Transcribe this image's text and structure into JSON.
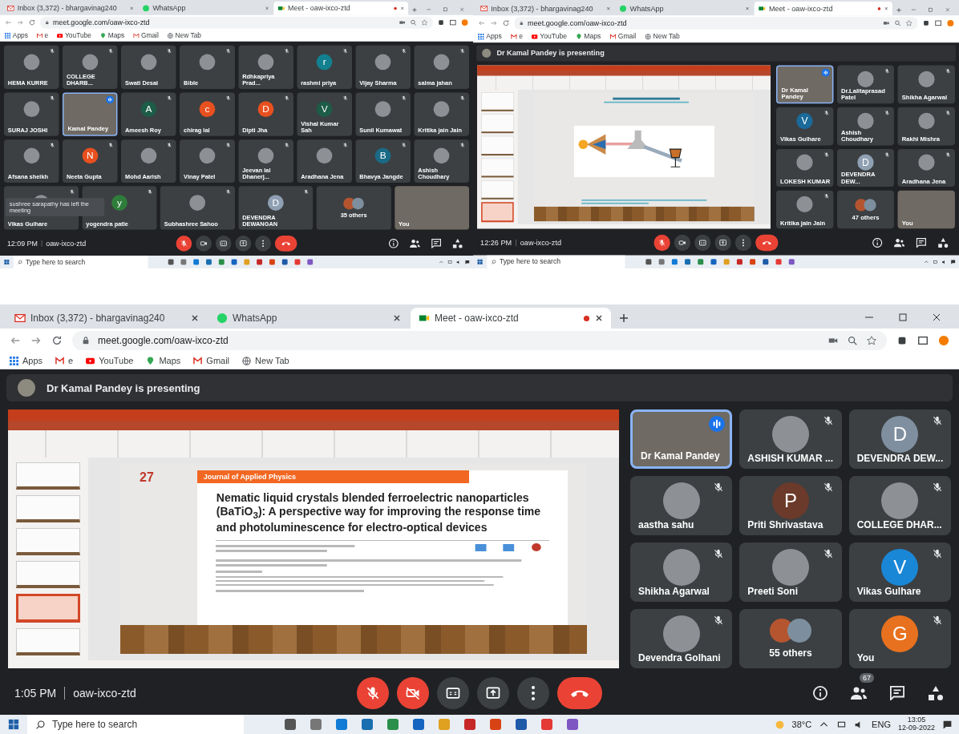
{
  "screens": [
    {
      "kind": "grid",
      "browser": {
        "tabs": [
          {
            "title": "Inbox (3,372) - bhargavinag240",
            "selected": false,
            "recording": false
          },
          {
            "title": "WhatsApp",
            "selected": false,
            "recording": false
          },
          {
            "title": "Meet - oaw-ixco-ztd",
            "selected": true,
            "recording": true
          }
        ],
        "url": "meet.google.com/oaw-ixco-ztd",
        "bookmarks": [
          "Apps",
          "e",
          "YouTube",
          "Maps",
          "Gmail",
          "New Tab"
        ]
      },
      "tiles": [
        {
          "name": "HEMA KURRE",
          "kind": "photo",
          "muted": true,
          "speaking": false
        },
        {
          "name": "COLLEGE DHARB...",
          "kind": "photo",
          "muted": true,
          "speaking": false
        },
        {
          "name": "Swati Desai",
          "kind": "photo",
          "muted": true,
          "speaking": false
        },
        {
          "name": "Bible",
          "kind": "photo",
          "muted": true,
          "speaking": false
        },
        {
          "name": "Rdhkapriya Prad...",
          "kind": "photo",
          "muted": true,
          "speaking": false
        },
        {
          "name": "rashmi priya",
          "kind": "letter",
          "letter": "r",
          "color": "#12808f",
          "muted": true,
          "speaking": false
        },
        {
          "name": "Vijay Sharma",
          "kind": "photo",
          "muted": true,
          "speaking": false
        },
        {
          "name": "salma jahan",
          "kind": "photo",
          "muted": true,
          "speaking": false
        },
        {
          "name": "SURAJ JOSHI",
          "kind": "photo",
          "muted": true,
          "speaking": false
        },
        {
          "name": "Kamal Pandey",
          "kind": "video",
          "muted": false,
          "speaking": true
        },
        {
          "name": "Ameesh Roy",
          "kind": "letter",
          "letter": "A",
          "color": "#1d5c47",
          "muted": true,
          "speaking": false
        },
        {
          "name": "chirag lal",
          "kind": "letter",
          "letter": "c",
          "color": "#e8501f",
          "muted": true,
          "speaking": false
        },
        {
          "name": "Dipti Jha",
          "kind": "letter",
          "letter": "D",
          "color": "#e8501f",
          "muted": true,
          "speaking": false
        },
        {
          "name": "Vishal Kumar Sah",
          "kind": "letter",
          "letter": "V",
          "color": "#1d5c47",
          "muted": true,
          "speaking": false
        },
        {
          "name": "Sunil Kumawat",
          "kind": "photo",
          "muted": true,
          "speaking": false
        },
        {
          "name": "Kritika jain Jain",
          "kind": "photo",
          "muted": true,
          "speaking": false
        },
        {
          "name": "Afsana sheikh",
          "kind": "photo",
          "muted": true,
          "speaking": false
        },
        {
          "name": "Neeta Gupta",
          "kind": "letter",
          "letter": "N",
          "color": "#e8501f",
          "muted": true,
          "speaking": false
        },
        {
          "name": "Mohd Aarish",
          "kind": "photo",
          "muted": true,
          "speaking": false
        },
        {
          "name": "Vinay Patel",
          "kind": "photo",
          "muted": true,
          "speaking": false
        },
        {
          "name": "Jeevan lal Dhanerj...",
          "kind": "photo",
          "muted": true,
          "speaking": false
        },
        {
          "name": "Aradhana Jena",
          "kind": "photo",
          "muted": true,
          "speaking": false
        },
        {
          "name": "Bhavya Jangde",
          "kind": "letter",
          "letter": "B",
          "color": "#1a6a86",
          "muted": true,
          "speaking": false
        },
        {
          "name": "Ashish Choudhary",
          "kind": "photo",
          "muted": true,
          "speaking": false
        },
        {
          "name": "Vikas Gulhare",
          "kind": "photo",
          "muted": true,
          "speaking": false
        },
        {
          "name": "yogendra patle",
          "kind": "letter",
          "letter": "y",
          "color": "#2f7d3a",
          "muted": true,
          "speaking": false
        },
        {
          "name": "Subhashree Sahoo",
          "kind": "photo",
          "muted": true,
          "speaking": false
        },
        {
          "name": "DEVENDRA DEWANGAN",
          "kind": "letter",
          "letter": "D",
          "color": "#8fa0b3",
          "muted": true,
          "speaking": false
        },
        {
          "name": "35 others",
          "kind": "group",
          "muted": false,
          "speaking": false
        },
        {
          "name": "You",
          "kind": "video",
          "muted": false,
          "speaking": false
        }
      ],
      "notification": "sushree sarapathy has left the meeting",
      "time": "12:09 PM",
      "code": "oaw-ixco-ztd",
      "controls": {
        "mic_on": false,
        "camera_on": true
      },
      "taskbar": {
        "search_placeholder": "Type here to search"
      }
    },
    {
      "kind": "presenting",
      "browser": {
        "tabs": [
          {
            "title": "Inbox (3,372) - bhargavinag240",
            "selected": false,
            "recording": false
          },
          {
            "title": "WhatsApp",
            "selected": false,
            "recording": false
          },
          {
            "title": "Meet - oaw-ixco-ztd",
            "selected": true,
            "recording": true
          }
        ],
        "url": "meet.google.com/oaw-ixco-ztd",
        "bookmarks": [
          "Apps",
          "e",
          "YouTube",
          "Maps",
          "Gmail",
          "New Tab"
        ]
      },
      "banner": "Dr Kamal Pandey is presenting",
      "slide": {
        "kind": "diagram",
        "thumbnails": [
          {
            "selected": false
          },
          {
            "selected": false
          },
          {
            "selected": false
          },
          {
            "selected": false
          },
          {
            "selected": false
          },
          {
            "selected": true
          }
        ]
      },
      "tiles": [
        {
          "name": "Dr Kamal Pandey",
          "kind": "video",
          "muted": false,
          "speaking": true
        },
        {
          "name": "Dr.Lalitaprasad Patel",
          "kind": "photo",
          "muted": true,
          "speaking": false
        },
        {
          "name": "Shikha Agarwal",
          "kind": "photo",
          "muted": true,
          "speaking": false
        },
        {
          "name": "Vikas Gulhare",
          "kind": "letter",
          "letter": "V",
          "color": "#1a6a9a",
          "muted": true,
          "speaking": false
        },
        {
          "name": "Ashish Choudhary",
          "kind": "photo",
          "muted": true,
          "speaking": false
        },
        {
          "name": "Rakhi Mishra",
          "kind": "photo",
          "muted": true,
          "speaking": false
        },
        {
          "name": "LOKESH KUMAR",
          "kind": "photo",
          "muted": true,
          "speaking": false
        },
        {
          "name": "DEVENDRA DEW...",
          "kind": "letter",
          "letter": "D",
          "color": "#8fa0b3",
          "muted": true,
          "speaking": false
        },
        {
          "name": "Aradhana Jena",
          "kind": "photo",
          "muted": true,
          "speaking": false
        },
        {
          "name": "Kritika jain Jain",
          "kind": "photo",
          "muted": true,
          "speaking": false
        },
        {
          "name": "47 others",
          "kind": "group",
          "muted": false,
          "speaking": false
        },
        {
          "name": "You",
          "kind": "video",
          "muted": false,
          "speaking": false
        }
      ],
      "time": "12:26 PM",
      "code": "oaw-ixco-ztd",
      "controls": {
        "mic_on": false,
        "camera_on": true
      },
      "taskbar": {
        "search_placeholder": "Type here to search"
      }
    },
    {
      "kind": "presenting",
      "browser": {
        "tabs": [
          {
            "title": "Inbox (3,372) - bhargavinag240",
            "selected": false,
            "recording": false
          },
          {
            "title": "WhatsApp",
            "selected": false,
            "recording": false
          },
          {
            "title": "Meet - oaw-ixco-ztd",
            "selected": true,
            "recording": true
          }
        ],
        "url": "meet.google.com/oaw-ixco-ztd",
        "bookmarks": [
          "Apps",
          "e",
          "YouTube",
          "Maps",
          "Gmail",
          "New Tab"
        ]
      },
      "banner": "Dr Kamal Pandey is presenting",
      "slide": {
        "kind": "article",
        "number": "27",
        "journal": "Journal of Applied Physics",
        "title": "Nematic liquid crystals blended ferroelectric nanoparticles (BaTiO$_{3}$): A perspective way for improving the response time and photoluminescence for electro-optical devices",
        "thumbnails": [
          {
            "selected": false
          },
          {
            "selected": false
          },
          {
            "selected": false
          },
          {
            "selected": false
          },
          {
            "selected": true
          },
          {
            "selected": false
          }
        ]
      },
      "tiles": [
        {
          "name": "Dr Kamal Pandey",
          "kind": "video",
          "muted": false,
          "speaking": true
        },
        {
          "name": "ASHISH KUMAR ...",
          "kind": "photo",
          "muted": true,
          "speaking": false
        },
        {
          "name": "DEVENDRA DEW...",
          "kind": "letter",
          "letter": "D",
          "color": "#7f8fa0",
          "muted": true,
          "speaking": false
        },
        {
          "name": "aastha sahu",
          "kind": "photo",
          "muted": true,
          "speaking": false
        },
        {
          "name": "Priti Shrivastava",
          "kind": "letter",
          "letter": "P",
          "color": "#6b3a2a",
          "muted": true,
          "speaking": false
        },
        {
          "name": "COLLEGE DHAR...",
          "kind": "photo",
          "muted": true,
          "speaking": false
        },
        {
          "name": "Shikha Agarwal",
          "kind": "photo",
          "muted": true,
          "speaking": false
        },
        {
          "name": "Preeti Soni",
          "kind": "photo",
          "muted": true,
          "speaking": false
        },
        {
          "name": "Vikas Gulhare",
          "kind": "letter",
          "letter": "V",
          "color": "#1a87d6",
          "muted": true,
          "speaking": false
        },
        {
          "name": "Devendra Golhani",
          "kind": "photo",
          "muted": true,
          "speaking": false
        },
        {
          "name": "55 others",
          "kind": "group",
          "muted": false,
          "speaking": false
        },
        {
          "name": "You",
          "kind": "letter",
          "letter": "G",
          "color": "#e8711f",
          "muted": true,
          "speaking": false
        }
      ],
      "time": "1:05 PM",
      "code": "oaw-ixco-ztd",
      "controls": {
        "mic_on": false,
        "camera_on": false,
        "participant_count": "67"
      },
      "taskbar": {
        "search_placeholder": "Type here to search",
        "weather": "38°C",
        "language": "ENG",
        "time": "13:05",
        "date": "12-09-2022"
      }
    }
  ]
}
